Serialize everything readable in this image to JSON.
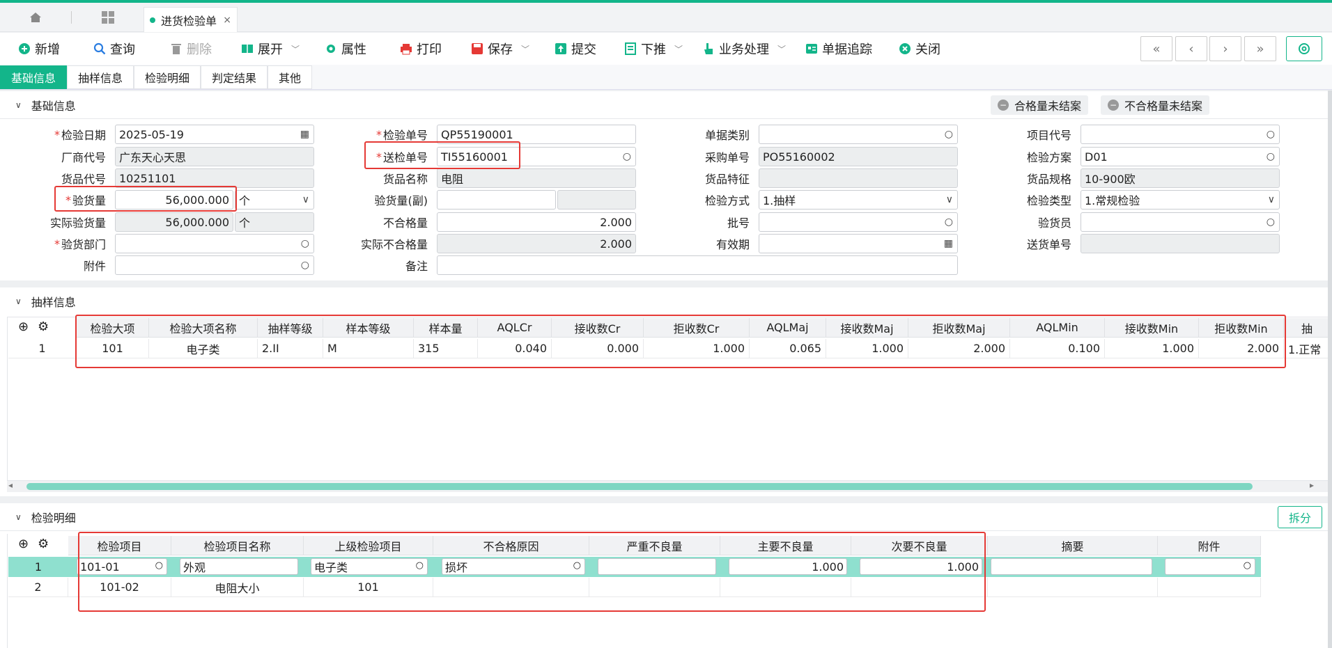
{
  "tabbar": {
    "home_icon": "home-icon",
    "grid_icon": "apps-grid-icon",
    "doc_tab_label": "进货检验单",
    "close_glyph": "×"
  },
  "toolbar": {
    "new": "新增",
    "query": "查询",
    "delete": "删除",
    "expand": "展开",
    "properties": "属性",
    "print": "打印",
    "save": "保存",
    "submit": "提交",
    "push_down": "下推",
    "business": "业务处理",
    "trace": "单据追踪",
    "close": "关闭",
    "nav": [
      "«",
      "‹",
      "›",
      "»"
    ]
  },
  "subtabs": [
    "基础信息",
    "抽样信息",
    "检验明细",
    "判定结果",
    "其他"
  ],
  "basic": {
    "section_title": "基础信息",
    "pill_pass": "合格量未结案",
    "pill_fail": "不合格量未结案",
    "col1": {
      "date_label": "检验日期",
      "date": "2025-05-19",
      "vendor_label": "厂商代号",
      "vendor": "广东天心天思",
      "item_label": "货品代号",
      "item": "10251101",
      "qty_label": "验货量",
      "qty": "56,000.000",
      "unit": "个",
      "actual_qty_label": "实际验货量",
      "actual_qty": "56,000.000",
      "actual_unit": "个",
      "dept_label": "验货部门",
      "dept": "",
      "attach_label": "附件",
      "attach": ""
    },
    "col2": {
      "inspect_no_label": "检验单号",
      "inspect_no": "QP55190001",
      "send_no_label": "送检单号",
      "send_no": "TI55160001",
      "item_name_label": "货品名称",
      "item_name": "电阻",
      "qty2_label": "验货量(副)",
      "qty2": "",
      "ng_label": "不合格量",
      "ng": "2.000",
      "actual_ng_label": "实际不合格量",
      "actual_ng": "2.000",
      "remark_label": "备注",
      "remark": ""
    },
    "col3": {
      "doc_type_label": "单据类别",
      "doc_type": "",
      "po_label": "采购单号",
      "po": "PO55160002",
      "feature_label": "货品特征",
      "feature": "",
      "method_label": "检验方式",
      "method": "1.抽样",
      "batch_label": "批号",
      "batch": "",
      "expiry_label": "有效期",
      "expiry": ""
    },
    "col4": {
      "project_label": "项目代号",
      "project": "",
      "plan_label": "检验方案",
      "plan": "D01",
      "spec_label": "货品规格",
      "spec": "10-900欧",
      "type_label": "检验类型",
      "type": "1.常规检验",
      "inspector_label": "验货员",
      "inspector": "",
      "delivery_label": "送货单号",
      "delivery": ""
    }
  },
  "sampling": {
    "section_title": "抽样信息",
    "headers": [
      "检验大项",
      "检验大项名称",
      "抽样等级",
      "样本等级",
      "样本量",
      "AQLCr",
      "接收数Cr",
      "拒收数Cr",
      "AQLMaj",
      "接收数Maj",
      "拒收数Maj",
      "AQLMin",
      "接收数Min",
      "拒收数Min",
      "抽"
    ],
    "rows": [
      [
        "1",
        "101",
        "电子类",
        "2.II",
        "M",
        "315",
        "0.040",
        "0.000",
        "1.000",
        "0.065",
        "1.000",
        "2.000",
        "0.100",
        "1.000",
        "2.000",
        "1.正常"
      ]
    ]
  },
  "detail": {
    "section_title": "检验明细",
    "split_label": "拆分",
    "headers": [
      "检验项目",
      "检验项目名称",
      "上级检验项目",
      "不合格原因",
      "严重不良量",
      "主要不良量",
      "次要不良量",
      "摘要",
      "附件"
    ],
    "rows": [
      [
        "1",
        "101-01",
        "外观",
        "电子类",
        "损坏",
        "",
        "1.000",
        "1.000",
        "",
        ""
      ],
      [
        "2",
        "101-02",
        "电阻大小",
        "101",
        "",
        "",
        "",
        "",
        "",
        ""
      ]
    ]
  },
  "colors": {
    "accent": "#13b58a",
    "highlight": "#e53935"
  }
}
